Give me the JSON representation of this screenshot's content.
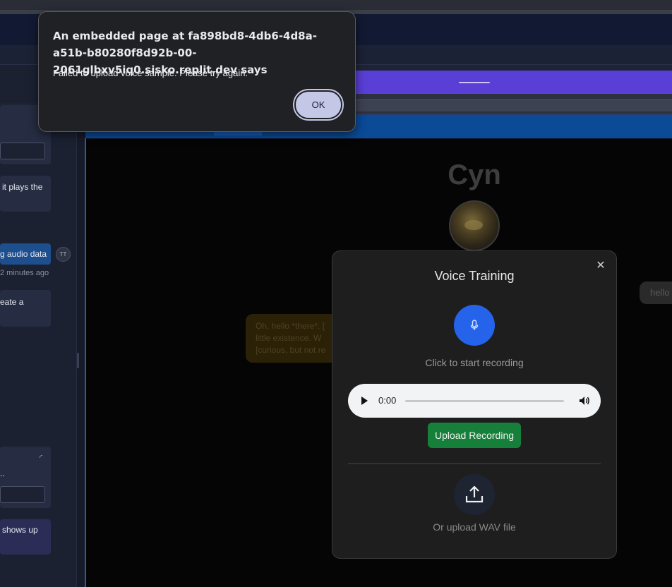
{
  "alert": {
    "title": "An embedded page at fa898bd8-4db6-4d8a-a51b-b80280f8d92b-00-2061glbxv5iq0.sisko.replit.dev says",
    "message": "Failed to upload voice sample. Please try again.",
    "ok_label": "OK"
  },
  "chat_panel": {
    "snippet_1": "it plays the",
    "user_message": "g audio data",
    "user_avatar_initials": "TT",
    "timestamp": "2 minutes ago",
    "snippet_2": "eate a",
    "snippet_3": "..",
    "snippet_4": "shows up"
  },
  "preview": {
    "app_title": "Cyn",
    "bot_message_lines": [
      "Oh, hello *there*. [",
      "little existence.  W",
      "[curious, but not re"
    ],
    "user_message": "hello"
  },
  "voice_training": {
    "title": "Voice Training",
    "record_label": "Click to start recording",
    "player_time": "0:00",
    "upload_button_label": "Upload Recording",
    "file_upload_label": "Or upload WAV file"
  },
  "colors": {
    "mic_button": "#2563eb",
    "upload_button": "#16803a",
    "alert_ok": "#c4c7e6",
    "preview_header_purple": "#5a3fd6",
    "preview_header_blue": "#0a4a96"
  },
  "icons": {
    "voice_training_close": "close-icon",
    "record": "microphone-icon",
    "player_play": "play-icon",
    "player_volume": "volume-icon",
    "file_upload": "upload-icon",
    "card_gauge": "gauge-icon"
  }
}
